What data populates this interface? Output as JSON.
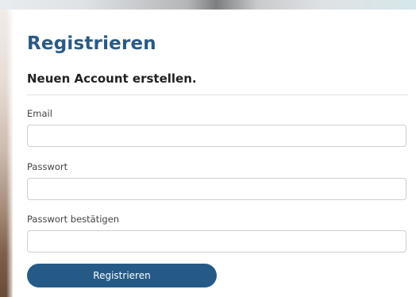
{
  "page": {
    "title": "Registrieren",
    "subtitle": "Neuen Account erstellen."
  },
  "form": {
    "fields": [
      {
        "label": "Email",
        "value": "",
        "placeholder": ""
      },
      {
        "label": "Passwort",
        "value": "",
        "placeholder": ""
      },
      {
        "label": "Passwort bestätigen",
        "value": "",
        "placeholder": ""
      }
    ],
    "submit_label": "Registrieren"
  },
  "colors": {
    "title": "#2a5a83",
    "button": "#255a87",
    "button_text": "#ffffff"
  }
}
